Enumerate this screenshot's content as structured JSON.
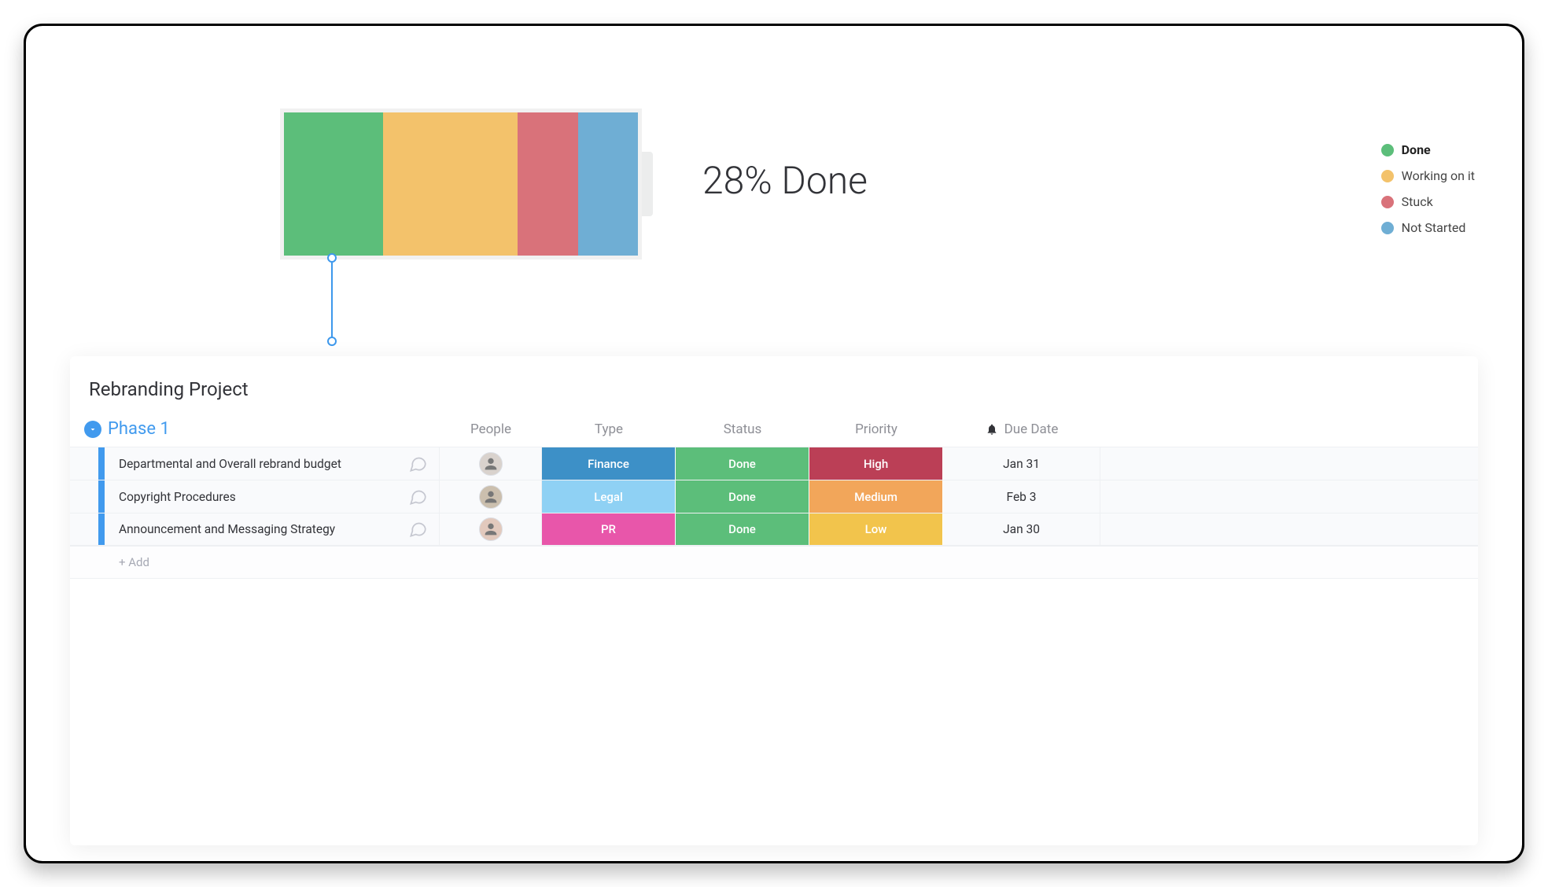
{
  "chart_data": {
    "type": "bar",
    "title": "28% Done",
    "series": [
      {
        "name": "Done",
        "value": 28,
        "color": "#5cbe7a"
      },
      {
        "name": "Working on it",
        "value": 38,
        "color": "#f3c26b"
      },
      {
        "name": "Stuck",
        "value": 17,
        "color": "#d9727a"
      },
      {
        "name": "Not Started",
        "value": 17,
        "color": "#6faed4"
      }
    ],
    "legend_bold_index": 0
  },
  "board": {
    "title": "Rebranding Project",
    "group_name": "Phase 1",
    "columns": {
      "people": "People",
      "type": "Type",
      "status": "Status",
      "priority": "Priority",
      "due": "Due Date"
    },
    "accent": "#419aee",
    "add_label": "+ Add",
    "rows": [
      {
        "task": "Departmental and Overall rebrand budget",
        "avatar_bg": "#d9d2cd",
        "type": {
          "label": "Finance",
          "color": "#3d90c7"
        },
        "status": {
          "label": "Done",
          "color": "#5cbe7a"
        },
        "priority": {
          "label": "High",
          "color": "#bb3f56"
        },
        "due": "Jan 31"
      },
      {
        "task": "Copyright Procedures",
        "avatar_bg": "#cbbfae",
        "type": {
          "label": "Legal",
          "color": "#8fd1f4"
        },
        "status": {
          "label": "Done",
          "color": "#5cbe7a"
        },
        "priority": {
          "label": "Medium",
          "color": "#f2a65a"
        },
        "due": "Feb 3"
      },
      {
        "task": "Announcement and Messaging Strategy",
        "avatar_bg": "#e2c9bd",
        "type": {
          "label": "PR",
          "color": "#e856aa"
        },
        "status": {
          "label": "Done",
          "color": "#5cbe7a"
        },
        "priority": {
          "label": "Low",
          "color": "#f2c44c"
        },
        "due": "Jan 30"
      }
    ]
  }
}
